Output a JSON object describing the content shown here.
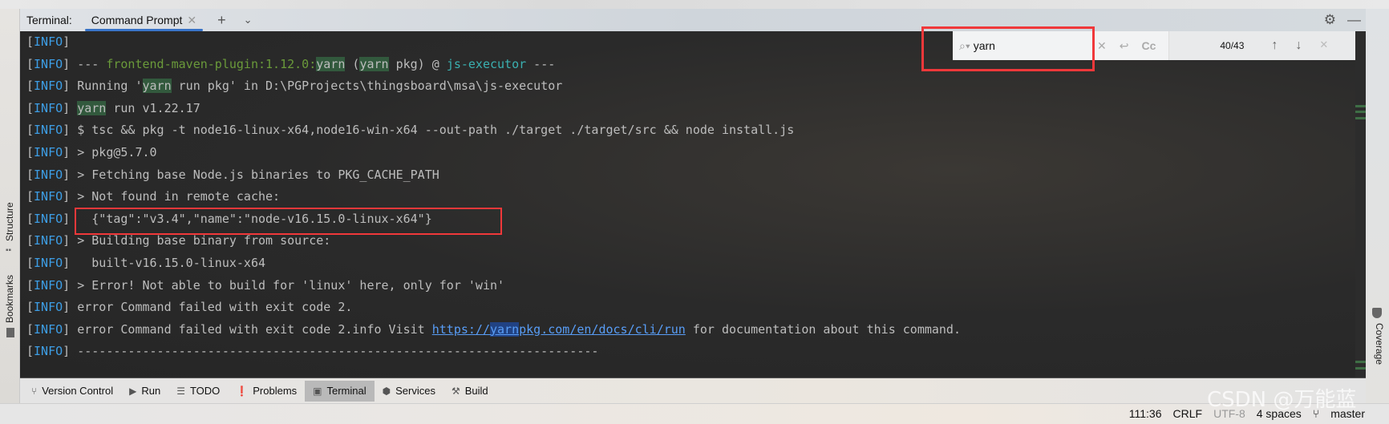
{
  "header": {
    "title": "Terminal:",
    "tab": "Command Prompt"
  },
  "sidebar_left": {
    "items": [
      {
        "label": "Structure"
      },
      {
        "label": "Bookmarks"
      }
    ]
  },
  "sidebar_right": {
    "items": [
      {
        "label": "Coverage"
      }
    ]
  },
  "search": {
    "query": "yarn",
    "match_count": "40/43",
    "case_label": "Cc"
  },
  "terminal": {
    "prefix_open": "[",
    "prefix_tag": "INFO",
    "prefix_close": "]",
    "lines": [
      {
        "parts": []
      },
      {
        "parts": [
          {
            "t": " --- "
          },
          {
            "t": "frontend-maven-plugin:1.12.0:",
            "c": "g"
          },
          {
            "t": "yarn",
            "c": "hl"
          },
          {
            "t": " ("
          },
          {
            "t": "yarn",
            "c": "hl"
          },
          {
            "t": " pkg) @ "
          },
          {
            "t": "js-executor",
            "c": "c"
          },
          {
            "t": " ---"
          }
        ]
      },
      {
        "parts": [
          {
            "t": " Running '"
          },
          {
            "t": "yarn",
            "c": "hl"
          },
          {
            "t": " run pkg' in D:\\PGProjects\\thingsboard\\msa\\js-executor"
          }
        ]
      },
      {
        "parts": [
          {
            "t": " "
          },
          {
            "t": "yarn",
            "c": "hl"
          },
          {
            "t": " run v1.22.17"
          }
        ]
      },
      {
        "parts": [
          {
            "t": " $ tsc && pkg -t node16-linux-x64,node16-win-x64 --out-path ./target ./target/src && node install.js"
          }
        ]
      },
      {
        "parts": [
          {
            "t": " > pkg@5.7.0"
          }
        ]
      },
      {
        "parts": [
          {
            "t": " > Fetching base Node.js binaries to PKG_CACHE_PATH"
          }
        ]
      },
      {
        "parts": [
          {
            "t": " > Not found in remote cache:"
          }
        ]
      },
      {
        "parts": [
          {
            "t": "   {\"tag\":\"v3.4\",\"name\":\"node-v16.15.0-linux-x64\"}"
          }
        ]
      },
      {
        "parts": [
          {
            "t": " > Building base binary from source:"
          }
        ]
      },
      {
        "parts": [
          {
            "t": "   built-v16.15.0-linux-x64"
          }
        ]
      },
      {
        "parts": [
          {
            "t": " > Error! Not able to build for 'linux' here, only for 'win'"
          }
        ]
      },
      {
        "parts": [
          {
            "t": " error Command failed with exit code 2."
          }
        ]
      },
      {
        "parts": [
          {
            "t": " error Command failed with exit code 2.info Visit "
          },
          {
            "t": "https://",
            "c": "a"
          },
          {
            "t": "yarn",
            "c": "a cur"
          },
          {
            "t": "pkg.com/en/docs/cli/run",
            "c": "a"
          },
          {
            "t": " for documentation about this command."
          }
        ]
      },
      {
        "parts": [
          {
            "t": " ------------------------------------------------------------------------"
          }
        ]
      }
    ]
  },
  "toolwindows": [
    {
      "label": "Version Control",
      "icon": "branch-icon"
    },
    {
      "label": "Run",
      "icon": "play-icon"
    },
    {
      "label": "TODO",
      "icon": "list-icon"
    },
    {
      "label": "Problems",
      "icon": "warning-icon"
    },
    {
      "label": "Terminal",
      "icon": "terminal-icon",
      "active": true
    },
    {
      "label": "Services",
      "icon": "services-icon"
    },
    {
      "label": "Build",
      "icon": "hammer-icon"
    }
  ],
  "status": {
    "position": "111:36",
    "line_sep": "CRLF",
    "encoding": "UTF-8",
    "indent": "4 spaces",
    "branch": "master"
  },
  "watermark": "CSDN @万能蓝",
  "colors": {
    "highlight": "#32593d",
    "current_match": "#214283",
    "info": "#3d9ee6",
    "annotation": "#f0383a",
    "tab_underline": "#3874c8"
  }
}
